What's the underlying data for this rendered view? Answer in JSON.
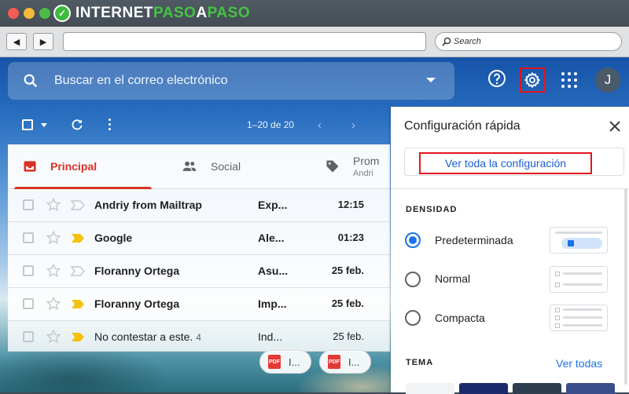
{
  "brand": {
    "part1": "INTERNET",
    "part2": "PASO",
    "part3": "A",
    "part4": "PASO"
  },
  "browser": {
    "back_label": "◀",
    "forward_label": "▶",
    "url": "",
    "search_placeholder": "Search"
  },
  "gmail": {
    "search_placeholder": "Buscar en el correo electrónico",
    "avatar_initial": "J",
    "pager": "1–20 de 20",
    "tabs": [
      {
        "label": "Principal"
      },
      {
        "label": "Social"
      },
      {
        "label": "Prom",
        "sub": "Andri"
      }
    ],
    "emails": [
      {
        "sender": "Andriy from Mailtrap",
        "count": "",
        "subject": "Exp...",
        "date": "12:15",
        "important": false
      },
      {
        "sender": "Google",
        "count": "",
        "subject": "Ale...",
        "date": "01:23",
        "important": true
      },
      {
        "sender": "Floranny Ortega",
        "count": "",
        "subject": "Asu...",
        "date": "25 feb.",
        "important": false
      },
      {
        "sender": "Floranny Ortega",
        "count": "",
        "subject": "Imp...",
        "date": "25 feb.",
        "important": true
      },
      {
        "sender": "No contestar a este.",
        "count": "4",
        "subject": "Ind...",
        "date": "25 feb.",
        "important": true
      }
    ],
    "attachments": [
      {
        "type": "PDF",
        "label": "I..."
      },
      {
        "type": "PDF",
        "label": "I..."
      }
    ]
  },
  "quick_settings": {
    "title": "Configuración rápida",
    "see_all": "Ver toda la configuración",
    "density_heading": "DENSIDAD",
    "density_options": [
      "Predeterminada",
      "Normal",
      "Compacta"
    ],
    "density_selected": "Predeterminada",
    "theme_heading": "TEMA",
    "theme_link": "Ver todas"
  },
  "colors": {
    "highlight": "#e2141b",
    "accent_red": "#d93025",
    "link_blue": "#1a73e8",
    "important_yellow": "#f4c20d"
  }
}
